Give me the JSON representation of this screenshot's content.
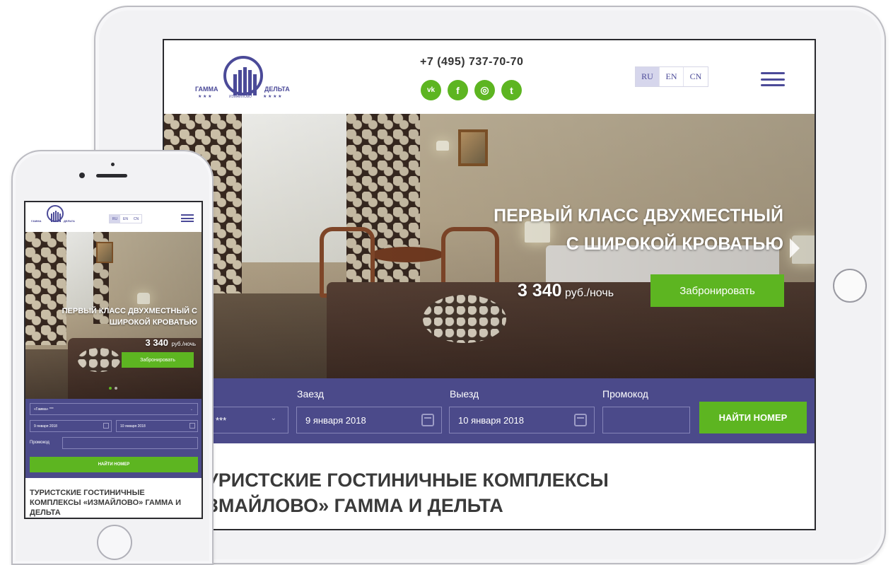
{
  "site": {
    "logo_left": "ГАММА",
    "logo_right": "ДЕЛЬТА",
    "logo_sub": "ИЗМАЙЛОВО",
    "logo_stars": "★ ★ ★",
    "logo_stars_right": "★ ★ ★ ★",
    "phone": "+7 (495) 737-70-70",
    "social_icons": [
      "vk-icon",
      "facebook-icon",
      "instagram-icon",
      "twitter-icon"
    ],
    "social_glyphs": [
      "vk",
      "f",
      "◎",
      "t"
    ],
    "languages": [
      "RU",
      "EN",
      "CN"
    ],
    "active_language": "RU"
  },
  "hero": {
    "title_line1": "ПЕРВЫЙ КЛАСС ДВУХМЕСТНЫЙ",
    "title_line2": "С ШИРОКОЙ КРОВАТЬЮ",
    "price": "3 340",
    "price_unit": "руб./ночь",
    "book_label": "Забронировать"
  },
  "booking": {
    "hotel_value": "***",
    "checkin_label": "Заезд",
    "checkin_value": "9 января 2018",
    "checkout_label": "Выезд",
    "checkout_value": "10 января 2018",
    "promo_label": "Промокод",
    "promo_value": "",
    "search_label": "НАЙТИ НОМЕР"
  },
  "section_heading": "УРИСТСКИЕ ГОСТИНИЧНЫЕ КОМПЛЕКСЫ\nЗМАЙЛОВО» ГАММА И ДЕЛЬТА",
  "mobile": {
    "languages": [
      "RU",
      "EN",
      "CN"
    ],
    "title_line1": "ПЕРВЫЙ КЛАСС ДВУХМЕСТНЫЙ С",
    "title_line2": "ШИРОКОЙ КРОВАТЬЮ",
    "price": "3 340",
    "price_unit": "руб./ночь",
    "book_label": "Забронировать",
    "hotel_value": "«Гамма» ***",
    "checkin_value": "9 января 2018",
    "checkout_value": "10 января 2018",
    "promo_label": "Промокод",
    "search_label": "НАЙТИ НОМЕР",
    "heading": "ТУРИСТСКИЕ ГОСТИНИЧНЫЕ КОМПЛЕКСЫ «ИЗМАЙЛОВО» ГАММА И ДЕЛЬТА"
  },
  "colors": {
    "brand_purple": "#4b4a98",
    "form_purple": "#4b4a8a",
    "accent_green": "#5db521"
  }
}
